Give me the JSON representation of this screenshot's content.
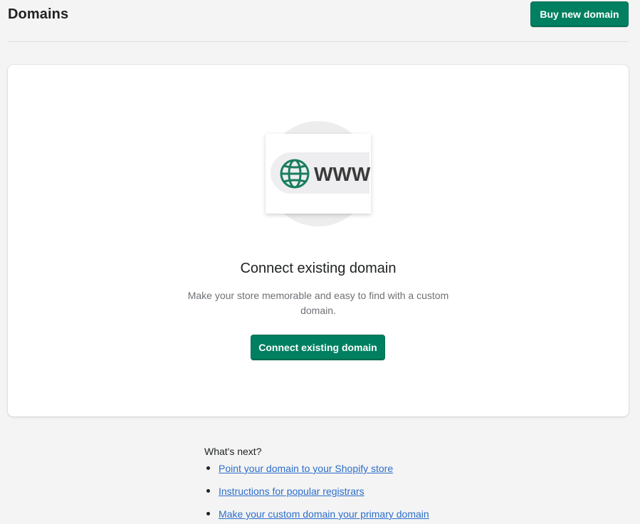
{
  "header": {
    "title": "Domains",
    "buy_button_label": "Buy new domain"
  },
  "empty_state": {
    "illustration_text": "WWW",
    "heading": "Connect existing domain",
    "description": "Make your store memorable and easy to find with a custom domain.",
    "button_label": "Connect existing domain"
  },
  "whats_next": {
    "title": "What's next?",
    "links": [
      {
        "label": "Point your domain to your Shopify store"
      },
      {
        "label": "Instructions for popular registrars"
      },
      {
        "label": "Make your custom domain your primary domain"
      }
    ]
  },
  "colors": {
    "primary": "#008060",
    "link": "#2c6ecb",
    "background": "#f4f4f4"
  }
}
